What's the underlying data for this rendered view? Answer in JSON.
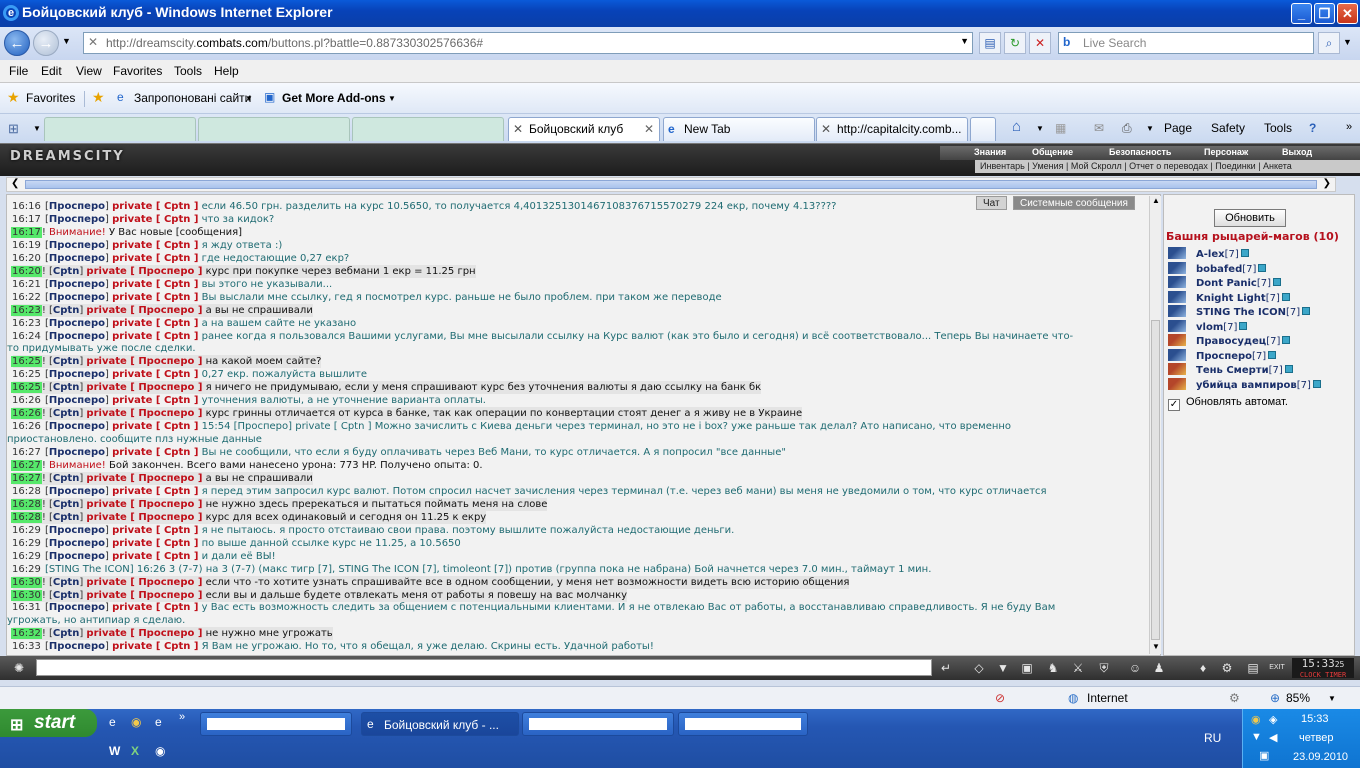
{
  "window": {
    "title": "Бойцовский клуб - Windows Internet Explorer"
  },
  "address": {
    "url_gray1": "http://dreamscity.",
    "url_domain": "combats.com",
    "url_gray2": "/buttons.pl?battle=0.887330302576636#",
    "search_placeholder": "Live Search"
  },
  "menu": [
    "File",
    "Edit",
    "View",
    "Favorites",
    "Tools",
    "Help"
  ],
  "favorites": {
    "label": "Favorites",
    "suggested": "Запропоновані сайти",
    "addons": "Get More Add-ons"
  },
  "tabs": [
    {
      "label": "Бойцовский клуб",
      "active": true
    },
    {
      "label": "New Tab",
      "active": false
    },
    {
      "label": "http://capitalcity.comb...",
      "active": false
    }
  ],
  "commands": {
    "page": "Page",
    "safety": "Safety",
    "tools": "Tools"
  },
  "game": {
    "logo": "DREAMSCITY",
    "menu": [
      "Знания",
      "Общение",
      "Безопасность",
      "Персонаж",
      "Выход"
    ],
    "submenu": "Инвентарь | Умения | Мой Скролл | Отчет о переводах | Поединки | Анкета"
  },
  "chat_tabs": {
    "chat": "Чат",
    "system": "Системные сообщения"
  },
  "chat": [
    {
      "t": "16:16",
      "hl": false,
      "from": "Просперо",
      "to": "Cptn",
      "text": "если 46.50 грн. разделить на курс 10.5650, то получается 4,40132513014671083767155702​79 224 екр, почему 4.13????",
      "mine": false
    },
    {
      "t": "16:17",
      "hl": false,
      "from": "Просперо",
      "to": "Cptn",
      "text": "что за кидок?",
      "mine": false
    },
    {
      "t": "16:17",
      "hl": true,
      "sys": "Внимание!",
      "text": "У Вас новые [сообщения]"
    },
    {
      "t": "16:19",
      "hl": false,
      "from": "Просперо",
      "to": "Cptn",
      "text": "я жду ответа :)",
      "mine": false
    },
    {
      "t": "16:20",
      "hl": false,
      "from": "Просперо",
      "to": "Cptn",
      "text": "где недостающие 0,27 екр?",
      "mine": false
    },
    {
      "t": "16:20",
      "hl": true,
      "from": "Cptn",
      "to": "Просперо",
      "text": "курс при покупке через вебмани 1 екр = 11.25 грн",
      "mine": true
    },
    {
      "t": "16:21",
      "hl": false,
      "from": "Просперо",
      "to": "Cptn",
      "text": "вы этого не указывали...",
      "mine": false
    },
    {
      "t": "16:22",
      "hl": false,
      "from": "Просперо",
      "to": "Cptn",
      "text": "Вы выслали мне ссылку, гед я посмотрел курс. раньше не было проблем. при таком же переводе",
      "mine": false
    },
    {
      "t": "16:23",
      "hl": true,
      "from": "Cptn",
      "to": "Просперо",
      "text": "а вы не спрашивали",
      "mine": true
    },
    {
      "t": "16:23",
      "hl": false,
      "from": "Просперо",
      "to": "Cptn",
      "text": "а на вашем сайте не указано",
      "mine": false
    },
    {
      "t": "16:24",
      "hl": false,
      "from": "Просперо",
      "to": "Cptn",
      "text": "ранее когда я пользовался Вашими услугами, Вы мне высылали ссылку на Курс валют (как это было и сегодня) и всё соответствовало... Теперь Вы начинаете что-",
      "mine": false
    },
    {
      "cont": "то придумывать уже после сделки."
    },
    {
      "t": "16:25",
      "hl": true,
      "from": "Cptn",
      "to": "Просперо",
      "text": "на какой моем сайте?",
      "mine": true
    },
    {
      "t": "16:25",
      "hl": false,
      "from": "Просперо",
      "to": "Cptn",
      "text": "0,27 екр. пожалуйста вышлите",
      "mine": false
    },
    {
      "t": "16:25",
      "hl": true,
      "from": "Cptn",
      "to": "Просперо",
      "text": "я ничего не придумываю, если у меня спрашивают курс без уточнения валюты я даю ссылку на банк бк",
      "mine": true
    },
    {
      "t": "16:26",
      "hl": false,
      "from": "Просперо",
      "to": "Cptn",
      "text": "уточнения валюты, а не уточнение варианта оплаты.",
      "mine": false
    },
    {
      "t": "16:26",
      "hl": true,
      "from": "Cptn",
      "to": "Просперо",
      "text": "курс гринны отличается от курса в банке, так как операции по конвертации стоят денег а я живу не в Украине",
      "mine": true
    },
    {
      "t": "16:26",
      "hl": false,
      "from": "Просперо",
      "to": "Cptn",
      "text": "15:54 [Просперо] private [ Cptn ] Можно зачислить с Киева деньги через терминал, но это не i box? уже раньше так делал? Ато написано, что временно",
      "mine": false
    },
    {
      "cont": "приостановлено. сообщите плз нужные данные"
    },
    {
      "t": "16:27",
      "hl": false,
      "from": "Просперо",
      "to": "Cptn",
      "text": "Вы не сообщили, что если я буду оплачивать через Веб Мани, то курс отличается. А я попросил \"все данные\"",
      "mine": false
    },
    {
      "t": "16:27",
      "hl": true,
      "sys": "Внимание!",
      "text": "Бой закончен. Всего вами нанесено урона: 773 HP. Получено опыта: 0."
    },
    {
      "t": "16:27",
      "hl": true,
      "from": "Cptn",
      "to": "Просперо",
      "text": "а вы не спрашивали",
      "mine": true
    },
    {
      "t": "16:28",
      "hl": false,
      "from": "Просперо",
      "to": "Cptn",
      "text": "я перед этим запросил курс валют. Потом спросил насчет зачисления через терминал (т.е. через веб мани) вы меня не уведомили о том, что курс отличается",
      "mine": false
    },
    {
      "t": "16:28",
      "hl": true,
      "from": "Cptn",
      "to": "Просперо",
      "text": "не нужно здесь пререкаться и пытаться поймать меня на слове",
      "mine": true
    },
    {
      "t": "16:28",
      "hl": true,
      "from": "Cptn",
      "to": "Просперо",
      "text": "курс для всех одинаковый и сегодня он 11.25 к екру",
      "mine": true
    },
    {
      "t": "16:29",
      "hl": false,
      "from": "Просперо",
      "to": "Cptn",
      "text": "я не пытаюсь. я просто отстаиваю свои права. поэтому вышлите пожалуйста недостающие деньги.",
      "mine": false
    },
    {
      "t": "16:29",
      "hl": false,
      "from": "Просперо",
      "to": "Cptn",
      "text": "по выше данной ссылке курс не 11.25, а 10.5650",
      "mine": false
    },
    {
      "t": "16:29",
      "hl": false,
      "from": "Просперо",
      "to": "Cptn",
      "text": "и дали её ВЫ!",
      "mine": false
    },
    {
      "t": "16:29",
      "hl": false,
      "battle": "[STING The ICON] 16:26 3 (7-7) на 3 (7-7) (макс тигр [7], STING The ICON [7], timoleont [7]) против (группа пока не набрана) Бой начнется через 7.0 мин., таймаут 1 мин."
    },
    {
      "t": "16:30",
      "hl": true,
      "from": "Cptn",
      "to": "Просперо",
      "text": "если что -то хотите узнать спрашивайте все в одном сообщении, у меня нет возможности видеть всю историю общения",
      "mine": true
    },
    {
      "t": "16:30",
      "hl": true,
      "from": "Cptn",
      "to": "Просперо",
      "text": "если вы и дальше будете отвлекать меня от работы я повешу на вас молчанку",
      "mine": true
    },
    {
      "t": "16:31",
      "hl": false,
      "from": "Просперо",
      "to": "Cptn",
      "text": "у Вас есть возможность следить за общением с потенциальными клиентами. И я не отвлекаю Вас от работы, а восстанавливаю справедливость. Я не буду Вам",
      "mine": false
    },
    {
      "cont": "угрожать, но антипиар я сделаю."
    },
    {
      "t": "16:32",
      "hl": true,
      "from": "Cptn",
      "to": "Просперо",
      "text": "не нужно мне угрожать",
      "mine": true
    },
    {
      "t": "16:33",
      "hl": false,
      "from": "Просперо",
      "to": "Cptn",
      "text": "Я Вам не угрожаю. Но то, что я обещал, я уже делаю. Скрины есть. Удачной работы!",
      "mine": false
    }
  ],
  "sidebar": {
    "refresh": "Обновить",
    "room": "Башня рыцарей-магов (10)",
    "users": [
      {
        "name": "A-lex",
        "lv": "[7]",
        "red": false
      },
      {
        "name": "bobafed",
        "lv": "[7]",
        "red": false
      },
      {
        "name": "Dont Panic",
        "lv": "[7]",
        "red": false
      },
      {
        "name": "Knight Light",
        "lv": "[7]",
        "red": false
      },
      {
        "name": "STING The ICON",
        "lv": "[7]",
        "red": false
      },
      {
        "name": "vlom",
        "lv": "[7]",
        "red": false
      },
      {
        "name": "Правосудец",
        "lv": "[7]",
        "red": true
      },
      {
        "name": "Просперо",
        "lv": "[7]",
        "red": false
      },
      {
        "name": "Тень Смерти",
        "lv": "[7]",
        "red": true
      },
      {
        "name": "убийца вампиров",
        "lv": "[7]",
        "red": true
      }
    ],
    "auto_refresh": "Обновлять автомат."
  },
  "clock": {
    "time": "15:33",
    "seconds": "25",
    "label1": "CLOCK",
    "label2": "TIMER"
  },
  "status": {
    "zone": "Internet",
    "zoom": "85%"
  },
  "taskbar": {
    "start": "start",
    "items": [
      {
        "label": "",
        "blank": true
      },
      {
        "label": "Бойцовский клуб - ...",
        "blank": false,
        "active": true
      },
      {
        "label": "",
        "blank": true
      },
      {
        "label": "",
        "blank": true
      }
    ],
    "lang": "RU",
    "time": "15:33",
    "day": "четвер",
    "date": "23.09.2010"
  }
}
